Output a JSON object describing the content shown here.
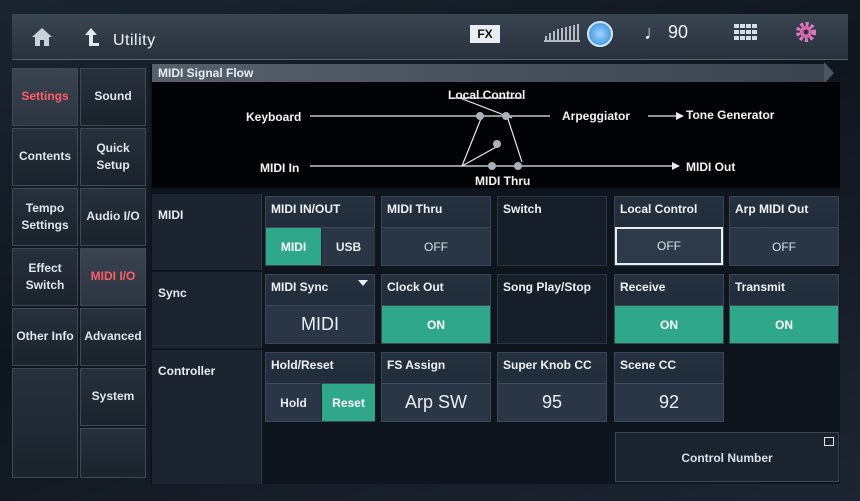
{
  "header": {
    "title": "Utility",
    "fx_label": "FX",
    "tempo_value": "90"
  },
  "tabs_primary": [
    "Settings",
    "Contents",
    "Tempo Settings",
    "Effect Switch",
    "Other Info"
  ],
  "tabs_secondary": [
    "Sound",
    "Quick Setup",
    "Audio I/O",
    "MIDI I/O",
    "Advanced",
    "System"
  ],
  "signal_flow": {
    "title": "MIDI Signal Flow",
    "keyboard": "Keyboard",
    "local_control": "Local Control",
    "arpeggiator": "Arpeggiator",
    "tone_generator": "Tone Generator",
    "midi_in": "MIDI In",
    "midi_thru": "MIDI Thru",
    "midi_out": "MIDI Out"
  },
  "rows": {
    "midi": "MIDI",
    "sync": "Sync",
    "controller": "Controller"
  },
  "midi_row": {
    "midi_in_out": {
      "label": "MIDI IN/OUT",
      "options": [
        "MIDI",
        "USB"
      ],
      "selected": "MIDI"
    },
    "midi_thru": {
      "label": "MIDI Thru",
      "value": "OFF"
    },
    "switch": {
      "label": "Switch"
    },
    "local_control": {
      "label": "Local Control",
      "value": "OFF"
    },
    "arp_midi_out": {
      "label": "Arp MIDI Out",
      "value": "OFF"
    }
  },
  "sync_row": {
    "midi_sync": {
      "label": "MIDI Sync",
      "value": "MIDI"
    },
    "clock_out": {
      "label": "Clock Out",
      "value": "ON"
    },
    "song_play_stop": {
      "label": "Song Play/Stop"
    },
    "receive": {
      "label": "Receive",
      "value": "ON"
    },
    "transmit": {
      "label": "Transmit",
      "value": "ON"
    }
  },
  "controller_row": {
    "hold_reset": {
      "label": "Hold/Reset",
      "options": [
        "Hold",
        "Reset"
      ],
      "selected": "Reset"
    },
    "fs_assign": {
      "label": "FS Assign",
      "value": "Arp SW"
    },
    "super_knob_cc": {
      "label": "Super Knob CC",
      "value": "95"
    },
    "scene_cc": {
      "label": "Scene CC",
      "value": "92"
    }
  },
  "control_number": "Control Number",
  "colors": {
    "accent_on": "#2ea889",
    "tab_active_text": "#ff5f66"
  }
}
